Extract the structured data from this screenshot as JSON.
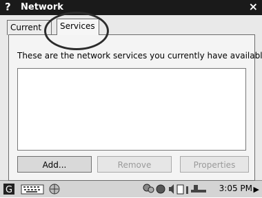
{
  "window": {
    "help_glyph": "?",
    "title": "Network",
    "close_glyph": "×"
  },
  "tabs": [
    {
      "label": "Current",
      "active": false
    },
    {
      "label": "Services",
      "active": true
    }
  ],
  "panel": {
    "description": "These are the network services you currently have available.",
    "services": []
  },
  "buttons": {
    "add": {
      "label": "Add...",
      "enabled": true
    },
    "remove": {
      "label": "Remove",
      "enabled": false
    },
    "properties": {
      "label": "Properties",
      "enabled": false
    }
  },
  "taskbar": {
    "icons": [
      "app-menu-icon",
      "keyboard-icon",
      "network-icon"
    ],
    "tray_icons": [
      "people-icon",
      "globe-icon",
      "speaker-icon",
      "battery-icon",
      "signal-icon",
      "power-plug-icon"
    ],
    "clock": "3:05 PM",
    "scroll_glyph": "▶"
  },
  "colors": {
    "titlebar": "#1a1a1a",
    "background": "#e9e9e9",
    "highlight_circle": "#2c2c2c"
  }
}
